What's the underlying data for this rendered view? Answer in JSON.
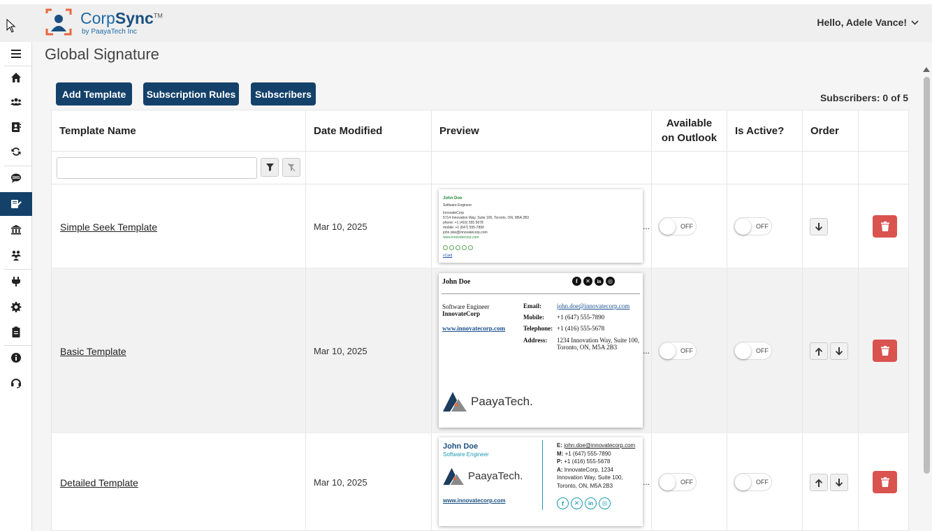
{
  "app": {
    "logo_word_a": "Corp",
    "logo_word_b": "Sync",
    "logo_tm": "TM",
    "logo_sub": "by PaayaTech Inc",
    "user_greeting": "Hello, Adele Vance!"
  },
  "page": {
    "title": "Global Signature"
  },
  "toolbar": {
    "add_template": "Add Template",
    "subscription_rules": "Subscription Rules",
    "subscribers": "Subscribers",
    "subscriber_count": "Subscribers: 0 of 5"
  },
  "table": {
    "headers": {
      "template_name": "Template Name",
      "date_modified": "Date Modified",
      "preview": "Preview",
      "available_line1": "Available",
      "available_line2": "on Outlook",
      "is_active": "Is Active?",
      "order": "Order"
    },
    "filter_value": "",
    "rows": [
      {
        "name": "Simple Seek Template",
        "date": "Mar 10, 2025",
        "available": "OFF",
        "active": "OFF",
        "ellipsis": "..."
      },
      {
        "name": "Basic Template",
        "date": "Mar 10, 2025",
        "available": "OFF",
        "active": "OFF",
        "ellipsis": "..."
      },
      {
        "name": "Detailed Template",
        "date": "Mar 10, 2025",
        "available": "OFF",
        "active": "OFF",
        "ellipsis": "..."
      }
    ]
  },
  "preview_simple": {
    "name": "John Doe",
    "title": "Software Engineer",
    "company": "InnovateCorp",
    "address": "5714 Innovation Way, Suite 100, Toronto, ON, M5A 2B3",
    "phone": "phone: +1 (416) 555 5678",
    "mobile": "mobile: +1 (647) 555-7890",
    "email": "john.doe@innovatecorp.com",
    "website": "www.innovatecorp.com",
    "vcard": "vCard"
  },
  "preview_basic": {
    "name": "John Doe",
    "title": "Software Engineer",
    "company": "InnovateCorp",
    "website": "www.innovatecorp.com",
    "email_label": "Email:",
    "email": "john.doe@innovatecorp.com",
    "mobile_label": "Mobile:",
    "mobile": "+1 (647) 555-7890",
    "telephone_label": "Telephone:",
    "telephone": "+1 (416) 555-5678",
    "address_label": "Address:",
    "address_line1": "1234 Innovation Way, Suite 100,",
    "address_line2": "Toronto, ON, M5A 2B3",
    "logo_text": "PaayaTech."
  },
  "preview_detailed": {
    "name": "John Doe",
    "title": "Software Engineer",
    "logo_text": "PaayaTech.",
    "website": "www.innovatecorp.com",
    "e_label": "E:",
    "email": "john.doe@innovatecorp.com",
    "m_label": "M:",
    "mobile": "+1 (647) 555-7890",
    "p_label": "P:",
    "phone": "+1 (416) 555-5678",
    "a_label": "A:",
    "address_line1": "InnovateCorp, 1234",
    "address_line2": "Innovation Way, Suite 100,",
    "address_line3": "Toronto, ON, M5A 2B3"
  },
  "colors": {
    "primary": "#14416a",
    "danger": "#d9534f",
    "accent_teal": "#1a9ab0"
  }
}
